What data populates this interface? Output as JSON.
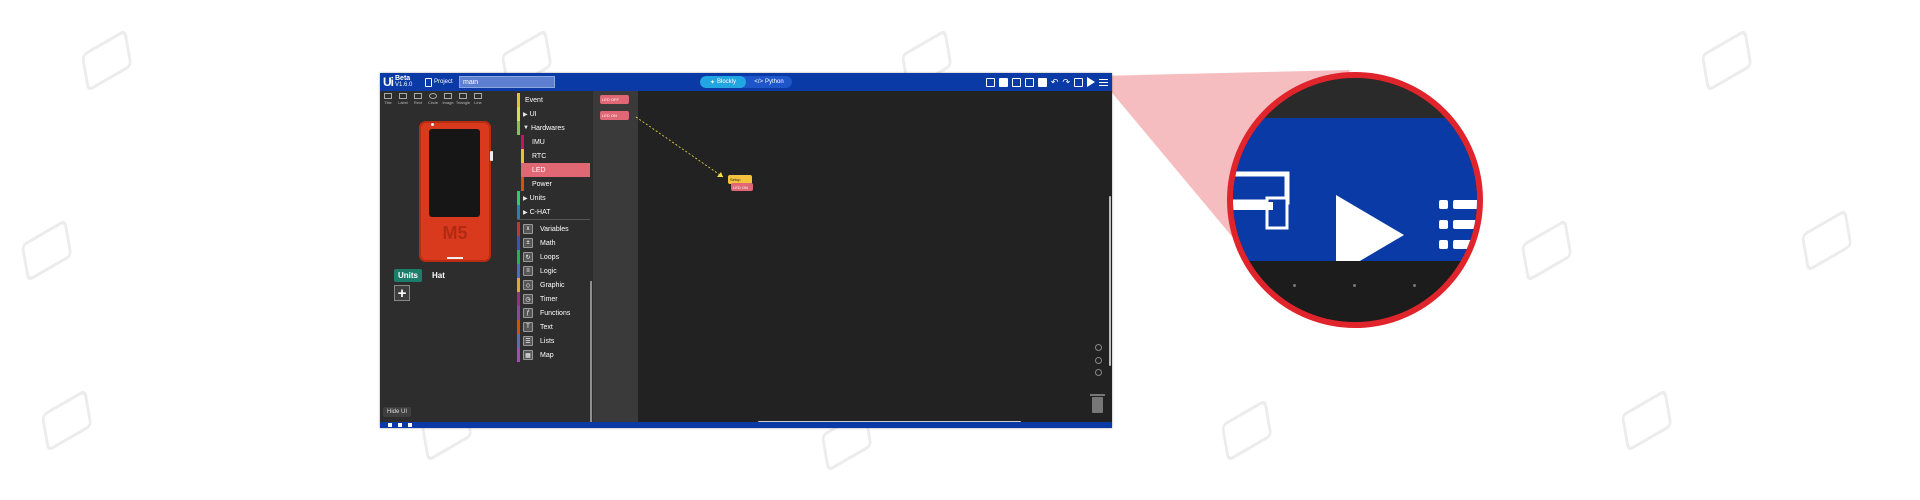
{
  "app": {
    "logo": "Ui",
    "beta_label": "Beta",
    "flow_label": "FLOW",
    "version": "V1.6.0",
    "project_label": "Project",
    "file_name": "main",
    "modes": [
      {
        "label": "Blockly",
        "active": true
      },
      {
        "label": "Python",
        "active": false
      }
    ]
  },
  "widget_tools": [
    "Title",
    "Label",
    "Rect",
    "Circle",
    "Image",
    "Triangle",
    "Line"
  ],
  "left_panel": {
    "device_brand": "M5",
    "tabs": [
      {
        "label": "Units",
        "active": true
      },
      {
        "label": "Hat",
        "active": false
      }
    ],
    "add_symbol": "+",
    "hide_ui_label": "Hide UI"
  },
  "categories": {
    "tree": [
      {
        "label": "Event",
        "color": "#e8c130"
      },
      {
        "label": "UI",
        "color": "#d4e157",
        "arrow": "▶"
      },
      {
        "label": "Hardwares",
        "color": "#8bc34a",
        "arrow": "▼"
      },
      {
        "label": "IMU",
        "color": "#c2185b",
        "sub": true
      },
      {
        "label": "RTC",
        "color": "#e8c130",
        "sub": true
      },
      {
        "label": "LED",
        "color": "#e06774",
        "sub": true,
        "selected": true
      },
      {
        "label": "Power",
        "color": "#d35400",
        "sub": true
      },
      {
        "label": "Units",
        "color": "#2ecc71",
        "arrow": "▶"
      },
      {
        "label": "C-HAT",
        "color": "#2980b9",
        "arrow": "▶"
      }
    ],
    "blocks": [
      {
        "label": "Variables",
        "color": "#c0392b"
      },
      {
        "label": "Math",
        "color": "#3f51b5"
      },
      {
        "label": "Loops",
        "color": "#27ae60"
      },
      {
        "label": "Logic",
        "color": "#4a6fc4"
      },
      {
        "label": "Graphic",
        "color": "#e8a530"
      },
      {
        "label": "Timer",
        "color": "#9c2a8f"
      },
      {
        "label": "Functions",
        "color": "#8e44ad"
      },
      {
        "label": "Text",
        "color": "#d35400"
      },
      {
        "label": "Lists",
        "color": "#5c6bc0"
      },
      {
        "label": "Map",
        "color": "#ab47bc"
      }
    ]
  },
  "flyout": {
    "blocks": [
      "LED OFF",
      "LED ON"
    ]
  },
  "workspace": {
    "setup_block": "Setup",
    "led_block": "LED ON"
  },
  "colors": {
    "topbar": "#0a3aa5",
    "workspace": "#222222",
    "callout_ring": "#e0242c",
    "callout_cone": "#f3b2b4",
    "led_block": "#e06774",
    "setup_block": "#f4c23c"
  }
}
